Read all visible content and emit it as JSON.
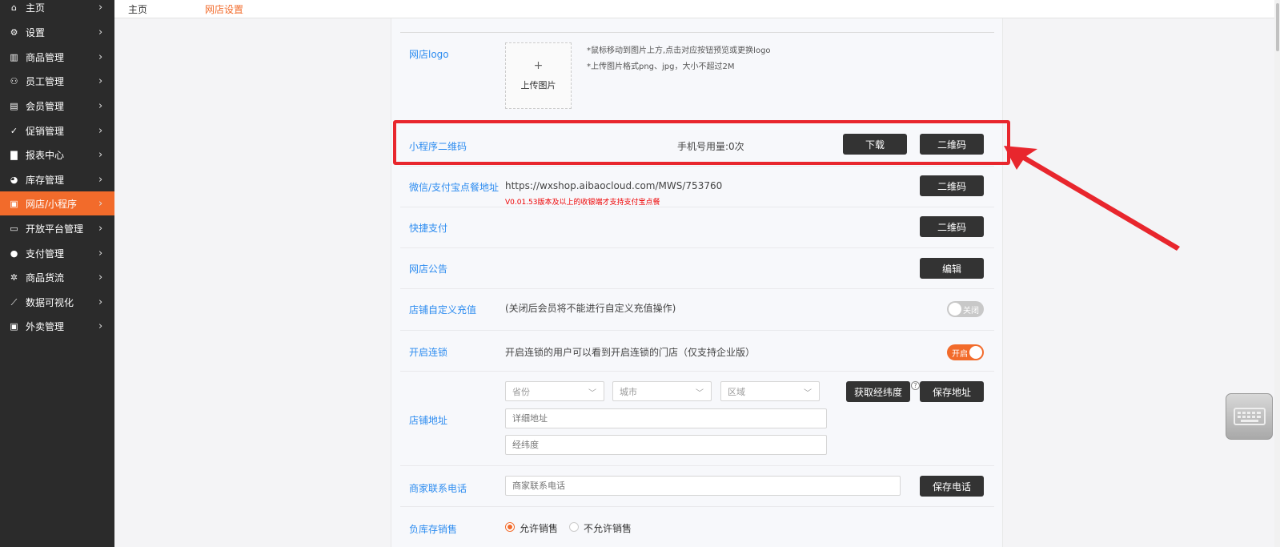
{
  "sidebar": {
    "items": [
      {
        "label": "主页",
        "icon": "home-icon",
        "glyph": "⌂",
        "active": false
      },
      {
        "label": "设置",
        "icon": "gear-icon",
        "glyph": "⚙",
        "active": false
      },
      {
        "label": "商品管理",
        "icon": "barcode-icon",
        "glyph": "▥",
        "active": false
      },
      {
        "label": "员工管理",
        "icon": "user-icon",
        "glyph": "⚇",
        "active": false
      },
      {
        "label": "会员管理",
        "icon": "member-card-icon",
        "glyph": "▤",
        "active": false
      },
      {
        "label": "促销管理",
        "icon": "check-circle-icon",
        "glyph": "✓",
        "active": false
      },
      {
        "label": "报表中心",
        "icon": "bar-chart-icon",
        "glyph": "▇",
        "active": false
      },
      {
        "label": "库存管理",
        "icon": "pie-chart-icon",
        "glyph": "◕",
        "active": false
      },
      {
        "label": "网店/小程序",
        "icon": "shop-icon",
        "glyph": "▣",
        "active": true
      },
      {
        "label": "开放平台管理",
        "icon": "monitor-icon",
        "glyph": "▭",
        "active": false
      },
      {
        "label": "支付管理",
        "icon": "coin-icon",
        "glyph": "●",
        "active": false
      },
      {
        "label": "商品货流",
        "icon": "flow-icon",
        "glyph": "✲",
        "active": false
      },
      {
        "label": "数据可视化",
        "icon": "line-chart-icon",
        "glyph": "⟋",
        "active": false
      },
      {
        "label": "外卖管理",
        "icon": "takeout-icon",
        "glyph": "▣",
        "active": false
      }
    ],
    "chevron": "›"
  },
  "breadcrumb": {
    "home": "主页",
    "current": "网店设置"
  },
  "logo_row": {
    "label": "网店logo",
    "upload_plus": "+",
    "upload_text": "上传图片",
    "hint1": "*鼠标移动到图片上方,点击对应按钮预览或更换logo",
    "hint2": "*上传图片格式png、jpg，大小不超过2M"
  },
  "mini_program_row": {
    "label": "小程序二维码",
    "usage": "手机号用量:0次",
    "download_btn": "下载",
    "qrcode_btn": "二维码"
  },
  "wechat_row": {
    "label": "微信/支付宝点餐地址",
    "url": "https://wxshop.aibaocloud.com/MWS/753760",
    "note": "V0.01.53版本及以上的收银端才支持支付宝点餐",
    "qrcode_btn": "二维码"
  },
  "quick_pay_row": {
    "label": "快捷支付",
    "qrcode_btn": "二维码"
  },
  "notice_row": {
    "label": "网店公告",
    "edit_btn": "编辑"
  },
  "custom_recharge_row": {
    "label": "店铺自定义充值",
    "desc": "(关闭后会员将不能进行自定义充值操作)",
    "toggle_text": "关闭",
    "toggle_on": false
  },
  "chain_row": {
    "label": "开启连锁",
    "desc": "开启连锁的用户可以看到开启连锁的门店（仅支持企业版）",
    "toggle_text": "开启",
    "toggle_on": true
  },
  "address_row": {
    "label": "店铺地址",
    "province_placeholder": "省份",
    "city_placeholder": "城市",
    "district_placeholder": "区域",
    "get_coords_btn": "获取经纬度",
    "help": "?",
    "save_address_btn": "保存地址",
    "detail_placeholder": "详细地址",
    "coords_placeholder": "经纬度"
  },
  "phone_row": {
    "label": "商家联系电话",
    "placeholder": "商家联系电话",
    "save_btn": "保存电话"
  },
  "negative_stock_row": {
    "label": "负库存销售",
    "option_allow": "允许销售",
    "option_deny": "不允许销售",
    "selected": "允许销售"
  },
  "colors": {
    "accent": "#f26b2b",
    "link": "#2d8cf0",
    "sidebar_bg": "#2b2b2b",
    "button_bg": "#333333",
    "annotation": "#e8262d"
  }
}
